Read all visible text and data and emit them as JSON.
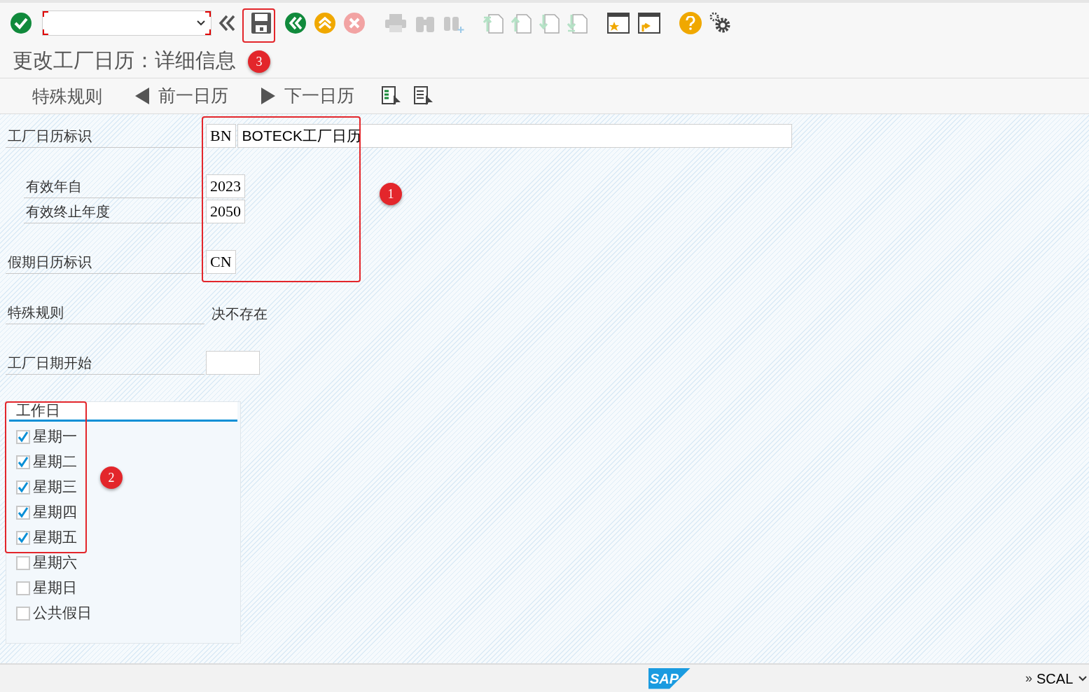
{
  "toolbar": [
    {
      "kind": "enter",
      "disabled": false
    },
    {
      "kind": "command"
    },
    {
      "kind": "collapse"
    },
    {
      "kind": "save",
      "disabled": false
    },
    {
      "kind": "back",
      "disabled": false
    },
    {
      "kind": "exit",
      "disabled": false
    },
    {
      "kind": "cancel",
      "disabled": false
    },
    {
      "kind": "print",
      "disabled": true
    },
    {
      "kind": "find",
      "disabled": true
    },
    {
      "kind": "find-next",
      "disabled": true
    },
    {
      "kind": "first-page",
      "disabled": true
    },
    {
      "kind": "prev-page",
      "disabled": true
    },
    {
      "kind": "next-page",
      "disabled": true
    },
    {
      "kind": "last-page",
      "disabled": true
    },
    {
      "kind": "new-session",
      "disabled": false
    },
    {
      "kind": "shortcut",
      "disabled": false
    },
    {
      "kind": "help",
      "disabled": false
    },
    {
      "kind": "settings",
      "disabled": false
    }
  ],
  "title": "更改工厂日历：详细信息",
  "app_toolbar": [
    {
      "kind": "text",
      "label": "特殊规则"
    },
    {
      "kind": "prev",
      "label": "前一日历"
    },
    {
      "kind": "next",
      "label": "下一日历"
    },
    {
      "kind": "icon-list"
    },
    {
      "kind": "icon-doc"
    }
  ],
  "fields": [
    {
      "label": "工厂日历标识",
      "kind": "id-desc",
      "value": "BN",
      "description": "BOTECK工厂日历",
      "indent": false
    },
    {
      "label": "有效年自",
      "kind": "input",
      "value": "2023",
      "indent": true
    },
    {
      "label": "有效终止年度",
      "kind": "input",
      "value": "2050",
      "indent": true
    },
    {
      "label": "假期日历标识",
      "kind": "input",
      "value": "CN",
      "indent": false
    },
    {
      "label": "特殊规则",
      "kind": "text",
      "value": "决不存在",
      "indent": false
    },
    {
      "label": "工厂日期开始",
      "kind": "input",
      "indent": false
    }
  ],
  "workdays": {
    "title": "工作日",
    "items": [
      {
        "label": "星期一",
        "checked": true
      },
      {
        "label": "星期二",
        "checked": true
      },
      {
        "label": "星期三",
        "checked": true
      },
      {
        "label": "星期四",
        "checked": true
      },
      {
        "label": "星期五",
        "checked": true
      },
      {
        "label": "星期六",
        "checked": false
      },
      {
        "label": "星期日",
        "checked": false
      },
      {
        "label": "公共假日",
        "checked": false
      }
    ]
  },
  "annotations": [
    {
      "label": "1"
    },
    {
      "label": "2"
    },
    {
      "label": "3"
    }
  ],
  "status_bar": {
    "logo": "SAP",
    "more": "»",
    "transaction": "SCAL"
  }
}
